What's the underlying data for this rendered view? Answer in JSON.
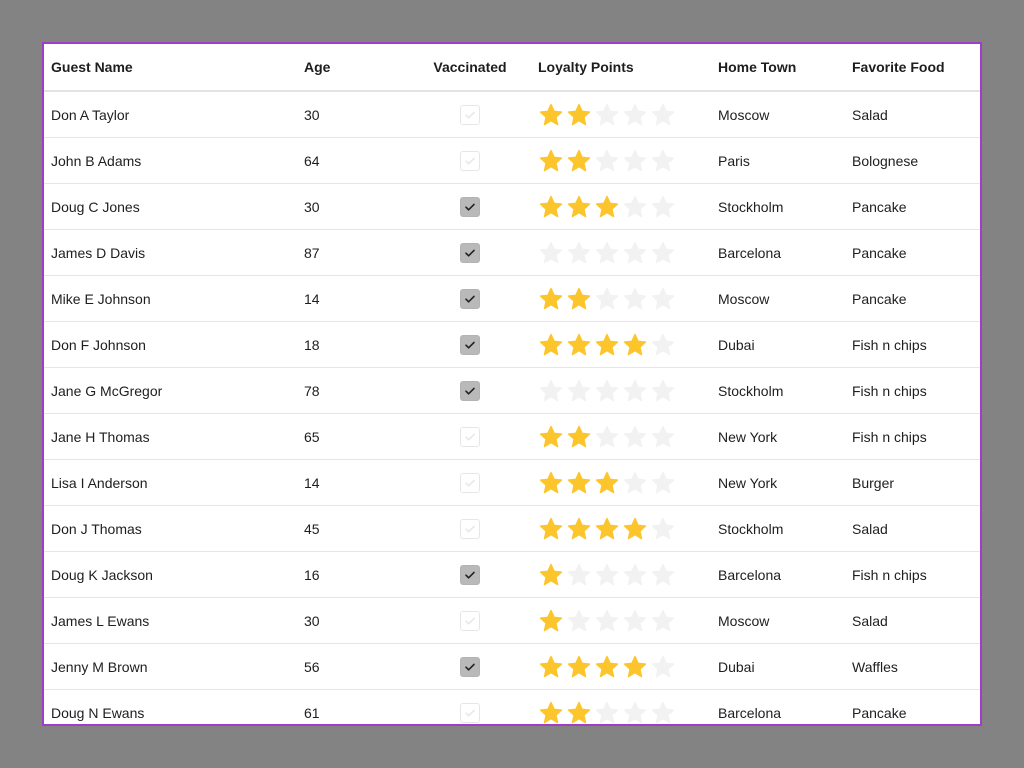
{
  "columns": [
    "Guest Name",
    "Age",
    "Vaccinated",
    "Loyalty Points",
    "Home Town",
    "Favorite Food"
  ],
  "colors": {
    "frame_border": "#a23bc7",
    "star_filled": "#fdc52c",
    "star_empty": "#f2f2f2",
    "checkbox_checked_bg": "#b9b9b9"
  },
  "max_stars": 5,
  "rows": [
    {
      "name": "Don A Taylor",
      "age": "30",
      "vaccinated": false,
      "stars": 2,
      "town": "Moscow",
      "food": "Salad"
    },
    {
      "name": "John B Adams",
      "age": "64",
      "vaccinated": false,
      "stars": 2,
      "town": "Paris",
      "food": "Bolognese"
    },
    {
      "name": "Doug C Jones",
      "age": "30",
      "vaccinated": true,
      "stars": 3,
      "town": "Stockholm",
      "food": "Pancake"
    },
    {
      "name": "James D Davis",
      "age": "87",
      "vaccinated": true,
      "stars": 0,
      "town": "Barcelona",
      "food": "Pancake"
    },
    {
      "name": "Mike E Johnson",
      "age": "14",
      "vaccinated": true,
      "stars": 2,
      "town": "Moscow",
      "food": "Pancake"
    },
    {
      "name": "Don F Johnson",
      "age": "18",
      "vaccinated": true,
      "stars": 4,
      "town": "Dubai",
      "food": "Fish n chips"
    },
    {
      "name": "Jane G McGregor",
      "age": "78",
      "vaccinated": true,
      "stars": 0,
      "town": "Stockholm",
      "food": "Fish n chips"
    },
    {
      "name": "Jane H Thomas",
      "age": "65",
      "vaccinated": false,
      "stars": 2,
      "town": "New York",
      "food": "Fish n chips"
    },
    {
      "name": "Lisa I Anderson",
      "age": "14",
      "vaccinated": false,
      "stars": 3,
      "town": "New York",
      "food": "Burger"
    },
    {
      "name": "Don J Thomas",
      "age": "45",
      "vaccinated": false,
      "stars": 4,
      "town": "Stockholm",
      "food": "Salad"
    },
    {
      "name": "Doug K Jackson",
      "age": "16",
      "vaccinated": true,
      "stars": 1,
      "town": "Barcelona",
      "food": "Fish n chips"
    },
    {
      "name": "James L Ewans",
      "age": "30",
      "vaccinated": false,
      "stars": 1,
      "town": "Moscow",
      "food": "Salad"
    },
    {
      "name": "Jenny M Brown",
      "age": "56",
      "vaccinated": true,
      "stars": 4,
      "town": "Dubai",
      "food": "Waffles"
    },
    {
      "name": "Doug N Ewans",
      "age": "61",
      "vaccinated": false,
      "stars": 2,
      "town": "Barcelona",
      "food": "Pancake"
    }
  ]
}
